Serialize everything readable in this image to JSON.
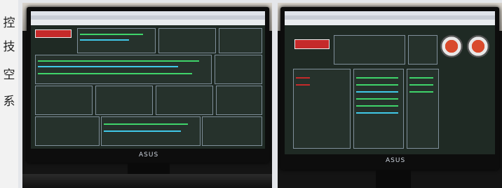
{
  "side_text": [
    "控",
    "技",
    "空",
    "系"
  ],
  "photos": [
    {
      "brand_label": "ASUS"
    },
    {
      "brand_label": "ASUS"
    }
  ],
  "colors": {
    "screen_bg": "#1f2a24",
    "value_green": "#3fd46a",
    "value_cyan": "#40c8e8",
    "alarm_red": "#c52a2a"
  }
}
